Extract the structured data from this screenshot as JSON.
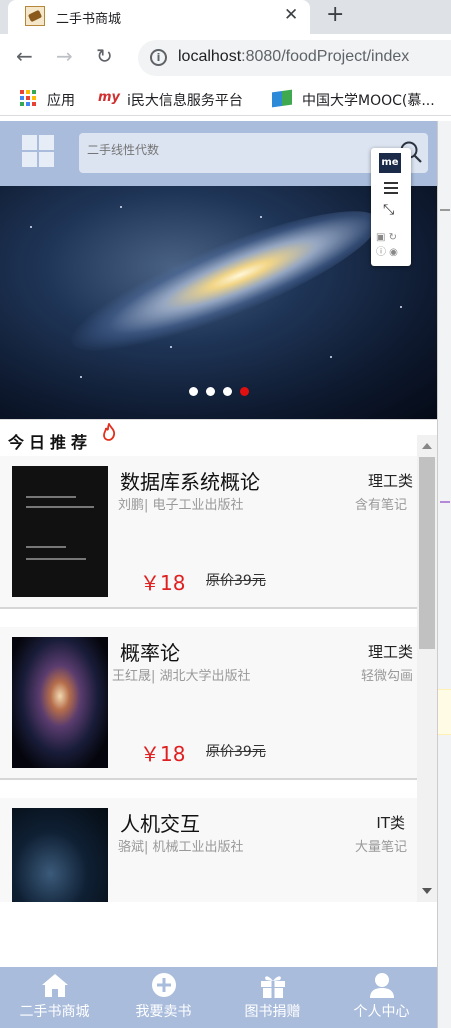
{
  "browser": {
    "tab_title": "二手书商城",
    "tab_close": "✕",
    "new_tab": "+",
    "url_host": "localhost",
    "url_rest": ":8080/foodProject/index",
    "bookmarks": [
      "应用",
      "i民大信息服务平台",
      "中国大学MOOC(慕..."
    ]
  },
  "header": {
    "search_placeholder": "二手线性代数"
  },
  "extension": {
    "logo": "me"
  },
  "carousel": {
    "slide_count": 4,
    "active_index": 3,
    "colors": {
      "active_dot": "#e01010",
      "dot": "#ffffff"
    }
  },
  "recommend": {
    "title": "今日推荐"
  },
  "books": [
    {
      "title": "数据库系统概论",
      "category": "理工类",
      "author": "刘鹏",
      "publisher": "电子工业出版社",
      "condition": "含有笔记",
      "price": "￥18",
      "original_price": "原价39元"
    },
    {
      "title": "概率论",
      "category": "理工类",
      "author": "王红晟",
      "publisher": "湖北大学出版社",
      "condition": "轻微勾画",
      "price": "￥18",
      "original_price": "原价39元"
    },
    {
      "title": "人机交互",
      "category": "IT类",
      "author": "骆斌",
      "publisher": "机械工业出版社",
      "condition": "大量笔记",
      "price": "",
      "original_price": ""
    }
  ],
  "bottom_nav": [
    {
      "label": "二手书商城",
      "icon": "home-icon"
    },
    {
      "label": "我要卖书",
      "icon": "plus-circle-icon"
    },
    {
      "label": "图书捐赠",
      "icon": "gift-icon"
    },
    {
      "label": "个人中心",
      "icon": "user-icon"
    }
  ],
  "colors": {
    "header_bg": "#a9bcdc",
    "price": "#e02020"
  }
}
